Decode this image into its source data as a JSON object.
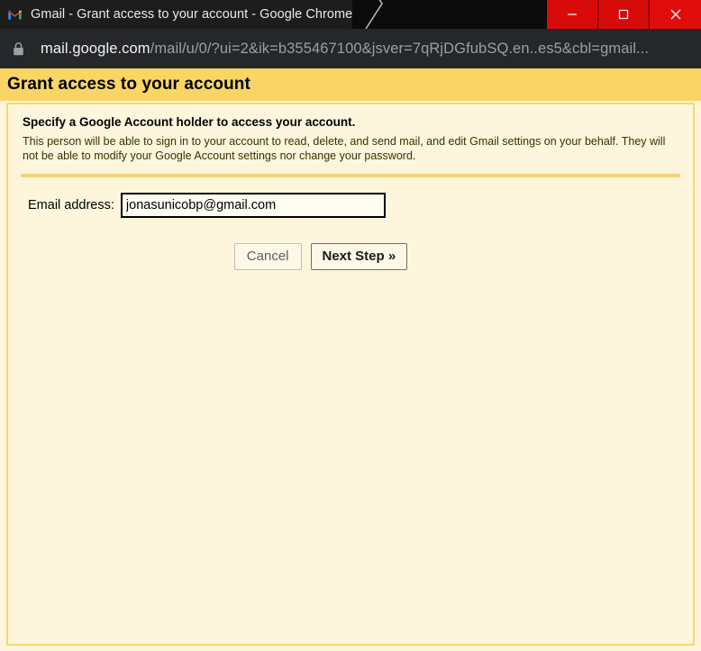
{
  "window": {
    "title": "Gmail - Grant access to your account - Google Chrome",
    "favicon": "gmail-m-icon",
    "controls": {
      "minimize": "minimize-icon",
      "maximize": "maximize-icon",
      "close": "close-icon"
    },
    "accent_color": "#d80b0b",
    "titlebar_color": "#0b0b0b",
    "tab_color": "#1d1d1d"
  },
  "omnibox": {
    "security_icon": "lock-icon",
    "url_domain": "mail.google.com",
    "url_path": "/mail/u/0/?ui=2&ik=b355467100&jsver=7qRjDGfubSQ.en..es5&cbl=gmail...",
    "background_color": "#262729"
  },
  "page": {
    "header_title": "Grant access to your account",
    "header_color": "#f8d564",
    "body_color": "#fdf6dd",
    "border_color": "#f6d86f",
    "intro_heading": "Specify a Google Account holder to access your account.",
    "intro_body": "This person will be able to sign in to your account to read, delete, and send mail, and edit Gmail settings on your behalf. They will not be able to modify your Google Account settings nor change your password.",
    "form": {
      "email_label": "Email address:",
      "email_value": "jonasunicobp@gmail.com",
      "email_placeholder": ""
    },
    "buttons": {
      "cancel": "Cancel",
      "next": "Next Step »"
    }
  }
}
